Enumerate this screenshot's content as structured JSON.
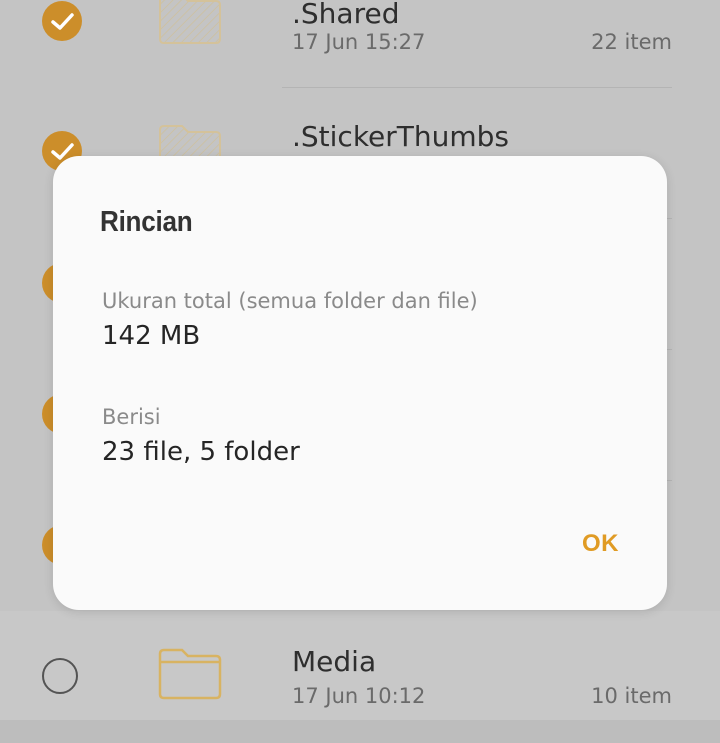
{
  "colors": {
    "accent": "#e09b24",
    "check_fill": "#cc8e2a",
    "folder_stroke": "#d8b362"
  },
  "file_list": {
    "rows": [
      {
        "name": ".Shared",
        "date": "17 Jun 15:27",
        "count": "22 item",
        "selected": true,
        "icon": "folder-icon"
      },
      {
        "name": ".StickerThumbs",
        "selected": true,
        "icon": "folder-icon"
      },
      {
        "name": "Media",
        "date": "17 Jun 10:12",
        "count": "10 item",
        "selected": false,
        "icon": "folder-icon"
      }
    ]
  },
  "dialog": {
    "title": "Rincian",
    "total_size_label": "Ukuran total (semua folder dan file)",
    "total_size_value": "142 MB",
    "contains_label": "Berisi",
    "contains_value": "23 file, 5 folder",
    "ok_label": "OK"
  }
}
